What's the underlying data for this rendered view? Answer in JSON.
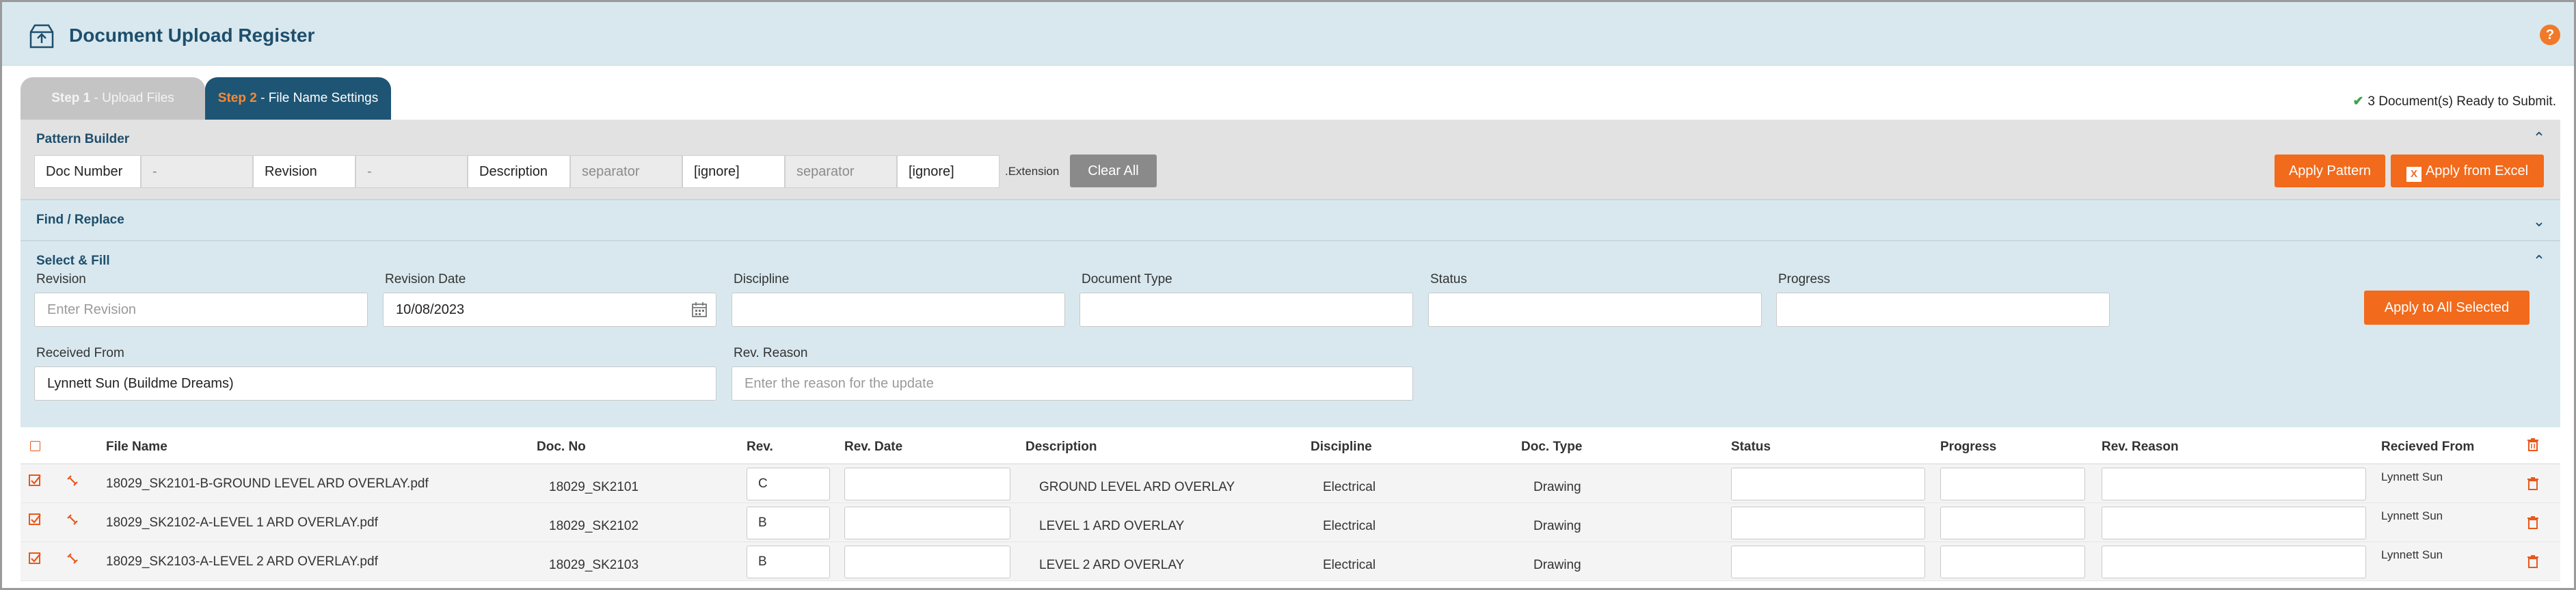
{
  "header": {
    "title": "Document Upload Register",
    "help": "?"
  },
  "tabs": [
    {
      "step": "Step 1",
      "label": "Upload Files"
    },
    {
      "step": "Step 2",
      "label": "File Name Settings"
    }
  ],
  "tab_sep": " - ",
  "status": {
    "ready": "3 Document(s) Ready to Submit."
  },
  "pattern_builder": {
    "title": "Pattern Builder",
    "segments": [
      {
        "text": "Doc Number",
        "kind": "field"
      },
      {
        "text": "-",
        "kind": "sep"
      },
      {
        "text": "Revision",
        "kind": "field"
      },
      {
        "text": "-",
        "kind": "sep"
      },
      {
        "text": "Description",
        "kind": "field"
      },
      {
        "text": "separator",
        "kind": "sep"
      },
      {
        "text": "[ignore]",
        "kind": "field"
      },
      {
        "text": "separator",
        "kind": "sep"
      },
      {
        "text": "[ignore]",
        "kind": "field"
      }
    ],
    "extension": ".Extension",
    "clear_all": "Clear All",
    "apply_pattern": "Apply Pattern",
    "apply_excel": "Apply from Excel"
  },
  "find_replace": {
    "title": "Find / Replace"
  },
  "select_fill": {
    "title": "Select & Fill",
    "revision_label": "Revision",
    "revision_placeholder": "Enter Revision",
    "revision_date_label": "Revision Date",
    "revision_date_value": "10/08/2023",
    "discipline_label": "Discipline",
    "doc_type_label": "Document Type",
    "status_label": "Status",
    "progress_label": "Progress",
    "apply_all": "Apply to All Selected",
    "received_from_label": "Received From",
    "received_from_value": "Lynnett Sun (Buildme Dreams)",
    "rev_reason_label": "Rev. Reason",
    "rev_reason_placeholder": "Enter the reason for the update"
  },
  "table": {
    "headers": [
      "File Name",
      "Doc. No",
      "Rev.",
      "Rev. Date",
      "Description",
      "Discipline",
      "Doc. Type",
      "Status",
      "Progress",
      "Rev. Reason",
      "Recieved From"
    ],
    "rows": [
      {
        "file": "18029_SK2101-B-GROUND LEVEL ARD OVERLAY.pdf",
        "doc_no": "18029_SK2101",
        "rev": "C",
        "description": "GROUND LEVEL ARD OVERLAY",
        "discipline": "Electrical",
        "doc_type": "Drawing",
        "received_from": "Lynnett Sun"
      },
      {
        "file": "18029_SK2102-A-LEVEL 1 ARD OVERLAY.pdf",
        "doc_no": "18029_SK2102",
        "rev": "B",
        "description": "LEVEL 1 ARD OVERLAY",
        "discipline": "Electrical",
        "doc_type": "Drawing",
        "received_from": "Lynnett Sun"
      },
      {
        "file": "18029_SK2103-A-LEVEL 2 ARD OVERLAY.pdf",
        "doc_no": "18029_SK2103",
        "rev": "B",
        "description": "LEVEL 2 ARD OVERLAY",
        "discipline": "Electrical",
        "doc_type": "Drawing",
        "received_from": "Lynnett Sun"
      }
    ]
  },
  "colors": {
    "accent": "#f26a1b",
    "brand": "#1e4e6c",
    "panel": "#d8e8ee"
  },
  "icons": [
    "upload-box-icon",
    "help-icon",
    "chevron-up-icon",
    "chevron-down-icon",
    "excel-icon",
    "calendar-icon",
    "checkbox-icon",
    "unlink-icon",
    "trash-icon",
    "check-icon"
  ]
}
